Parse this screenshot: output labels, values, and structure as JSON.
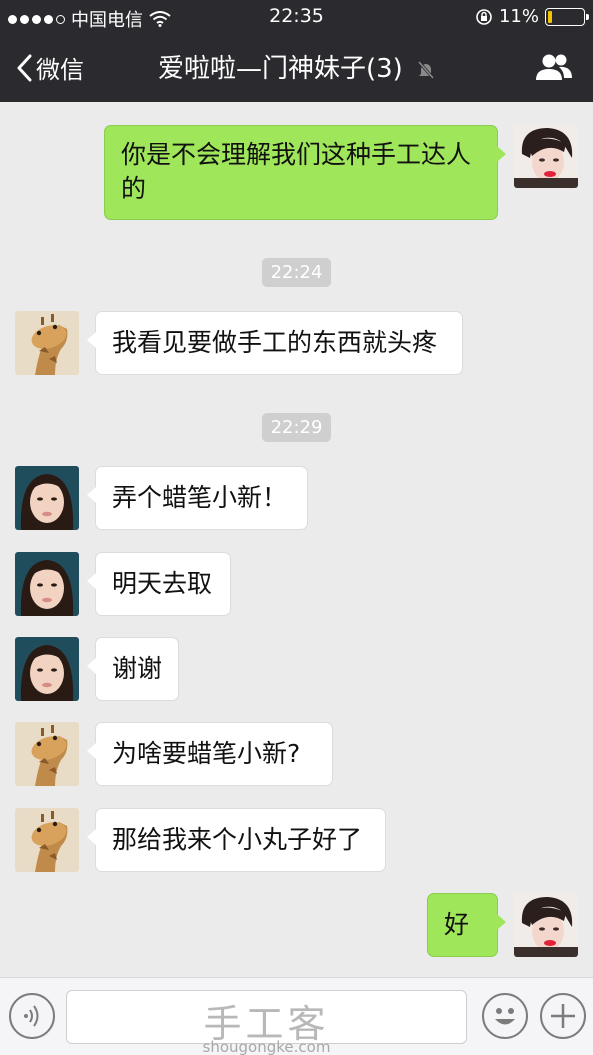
{
  "status_bar": {
    "carrier": "中国电信",
    "time": "22:35",
    "battery": "11%",
    "battery_level": 0.11
  },
  "nav": {
    "back_label": "微信",
    "title": "爱啦啦—门神妹子(3)"
  },
  "messages": [
    {
      "type": "text",
      "direction": "out",
      "sender": "self",
      "text_lines": [
        "你是不会理解我们这种手工达人",
        "的"
      ]
    },
    {
      "type": "time",
      "text": "22:24"
    },
    {
      "type": "text",
      "direction": "in",
      "sender": "giraffe",
      "text": "我看见要做手工的东西就头疼"
    },
    {
      "type": "time",
      "text": "22:29"
    },
    {
      "type": "text",
      "direction": "in",
      "sender": "girl",
      "text": "弄个蜡笔小新！"
    },
    {
      "type": "text",
      "direction": "in",
      "sender": "girl",
      "text": "明天去取"
    },
    {
      "type": "text",
      "direction": "in",
      "sender": "girl",
      "text": "谢谢"
    },
    {
      "type": "text",
      "direction": "in",
      "sender": "giraffe",
      "text": "为啥要蜡笔小新?"
    },
    {
      "type": "text",
      "direction": "in",
      "sender": "giraffe",
      "text": "那给我来个小丸子好了"
    },
    {
      "type": "text",
      "direction": "out",
      "sender": "self",
      "text": "好"
    }
  ],
  "input_bar": {
    "watermark_cn": "手工客",
    "watermark_en": "shougongke.com"
  },
  "icons": {
    "back": "chevron-left-icon",
    "mute": "bell-slash-icon",
    "people": "group-icon",
    "voice": "voice-icon",
    "emoji": "emoji-icon",
    "add": "plus-icon"
  },
  "colors": {
    "nav_bg": "#2b2a2f",
    "bubble_out": "#9fe65a",
    "bubble_in": "#ffffff",
    "chat_bg": "#ebebeb"
  }
}
